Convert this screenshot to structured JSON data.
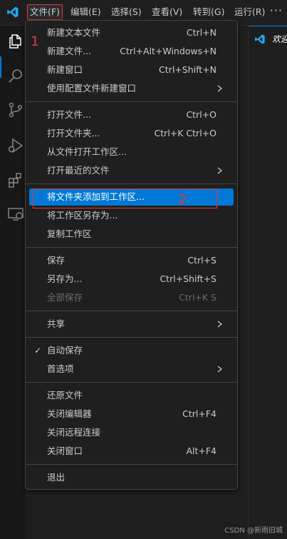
{
  "menubar": {
    "items": [
      "文件(F)",
      "编辑(E)",
      "选择(S)",
      "查看(V)",
      "转到(G)",
      "运行(R)"
    ],
    "more": "···"
  },
  "editor": {
    "tab_label": "欢迎"
  },
  "file_menu": {
    "groups": [
      [
        {
          "label": "新建文本文件",
          "shortcut": "Ctrl+N"
        },
        {
          "label": "新建文件...",
          "shortcut": "Ctrl+Alt+Windows+N"
        },
        {
          "label": "新建窗口",
          "shortcut": "Ctrl+Shift+N"
        },
        {
          "label": "使用配置文件新建窗口",
          "submenu": true
        }
      ],
      [
        {
          "label": "打开文件...",
          "shortcut": "Ctrl+O"
        },
        {
          "label": "打开文件夹...",
          "shortcut": "Ctrl+K Ctrl+O"
        },
        {
          "label": "从文件打开工作区..."
        },
        {
          "label": "打开最近的文件",
          "submenu": true
        }
      ],
      [
        {
          "label": "将文件夹添加到工作区...",
          "highlighted": true
        },
        {
          "label": "将工作区另存为..."
        },
        {
          "label": "复制工作区"
        }
      ],
      [
        {
          "label": "保存",
          "shortcut": "Ctrl+S"
        },
        {
          "label": "另存为...",
          "shortcut": "Ctrl+Shift+S"
        },
        {
          "label": "全部保存",
          "shortcut": "Ctrl+K S",
          "disabled": true
        }
      ],
      [
        {
          "label": "共享",
          "submenu": true
        }
      ],
      [
        {
          "label": "自动保存",
          "checked": true
        },
        {
          "label": "首选项",
          "submenu": true
        }
      ],
      [
        {
          "label": "还原文件"
        },
        {
          "label": "关闭编辑器",
          "shortcut": "Ctrl+F4"
        },
        {
          "label": "关闭远程连接"
        },
        {
          "label": "关闭窗口",
          "shortcut": "Alt+F4"
        }
      ],
      [
        {
          "label": "退出"
        }
      ]
    ]
  },
  "annotations": {
    "step1": "1",
    "step2": "2"
  },
  "watermark": "CSDN @新雨旧城",
  "colors": {
    "accent": "#0078d4",
    "annotation": "#e03a3a",
    "background": "#1f1f1f"
  },
  "icons": {
    "logo": "vscode-logo-icon",
    "activity": [
      "explorer-icon",
      "search-icon",
      "source-control-icon",
      "run-debug-icon",
      "extensions-icon",
      "remote-explorer-icon"
    ]
  }
}
